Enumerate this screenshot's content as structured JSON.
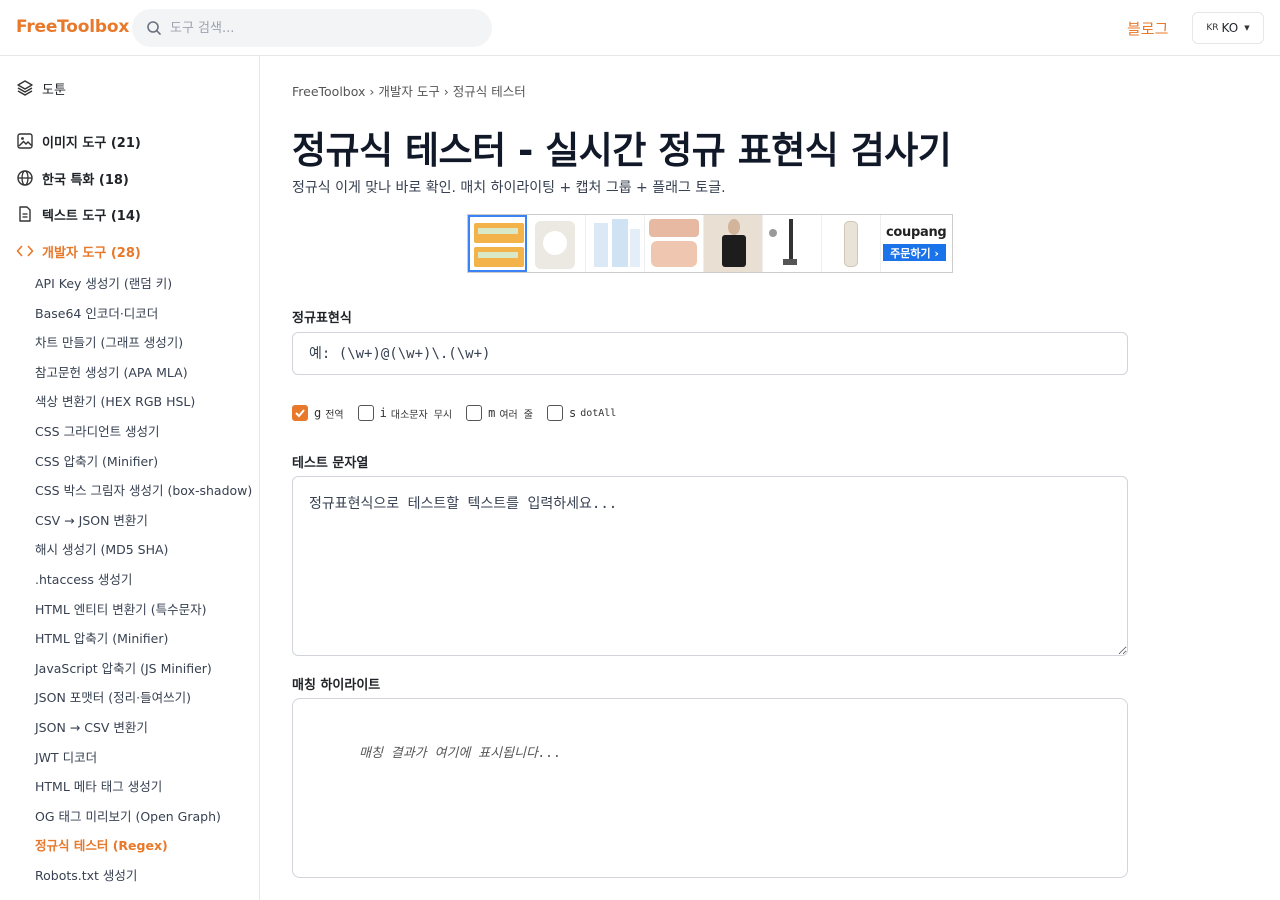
{
  "header": {
    "logo": "FreeToolbox",
    "search_placeholder": "도구 검색...",
    "blog_label": "블로그",
    "lang_flag": "KR",
    "lang_label": "KO"
  },
  "sidebar": {
    "top": "도툰",
    "categories": [
      {
        "label": "이미지 도구 (21)",
        "icon": "image-icon"
      },
      {
        "label": "한국 특화 (18)",
        "icon": "globe-icon"
      },
      {
        "label": "텍스트 도구 (14)",
        "icon": "document-icon"
      },
      {
        "label": "개발자 도구 (28)",
        "icon": "code-icon"
      }
    ],
    "items": [
      "API Key 생성기 (랜덤 키)",
      "Base64 인코더·디코더",
      "차트 만들기 (그래프 생성기)",
      "참고문헌 생성기 (APA MLA)",
      "색상 변환기 (HEX RGB HSL)",
      "CSS 그라디언트 생성기",
      "CSS 압축기 (Minifier)",
      "CSS 박스 그림자 생성기 (box-shadow)",
      "CSV → JSON 변환기",
      "해시 생성기 (MD5 SHA)",
      ".htaccess 생성기",
      "HTML 엔티티 변환기 (특수문자)",
      "HTML 압축기 (Minifier)",
      "JavaScript 압축기 (JS Minifier)",
      "JSON 포맷터 (정리·들여쓰기)",
      "JSON → CSV 변환기",
      "JWT 디코더",
      "HTML 메타 태그 생성기",
      "OG 태그 미리보기 (Open Graph)",
      "정규식 테스터 (Regex)",
      "Robots.txt 생성기"
    ]
  },
  "main": {
    "breadcrumb": "FreeToolbox › 개발자 도구 › 정규식 테스터",
    "title": "정규식 테스터 - 실시간 정규 표현식 검사기",
    "subtitle": "정규식 이게 맞나 바로 확인. 매치 하이라이팅 + 캡처 그룹 + 플래그 토글.",
    "ad": {
      "brand": "coupang",
      "cta": "주문하기 ›"
    },
    "regex_label": "정규표현식",
    "regex_placeholder": "예: (\\w+)@(\\w+)\\.(\\w+)",
    "flags": [
      {
        "letter": "g",
        "desc": "전역",
        "checked": true
      },
      {
        "letter": "i",
        "desc": "대소문자 무시",
        "checked": false
      },
      {
        "letter": "m",
        "desc": "여러 줄",
        "checked": false
      },
      {
        "letter": "s",
        "desc": "dotAll",
        "checked": false
      }
    ],
    "test_label": "테스트 문자열",
    "test_placeholder": "정규표현식으로 테스트할 텍스트를 입력하세요...",
    "match_label": "매칭 하이라이트",
    "match_placeholder": "매칭 결과가 여기에 표시됩니다..."
  },
  "colors": {
    "accent": "#e8782a",
    "link_blue": "#1a73e8"
  }
}
